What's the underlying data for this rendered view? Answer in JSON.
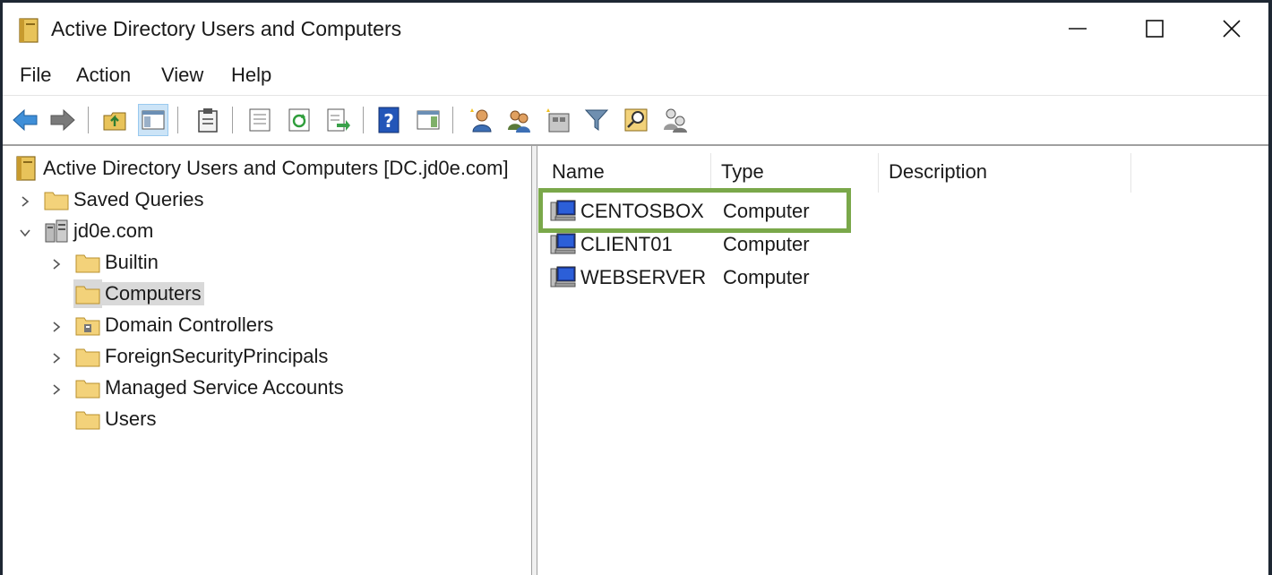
{
  "window": {
    "title": "Active Directory Users and Computers",
    "controls": [
      "minimize",
      "maximize",
      "close"
    ]
  },
  "menu": {
    "file": "File",
    "action": "Action",
    "view": "View",
    "help": "Help"
  },
  "toolbar": {
    "icons": [
      "back-arrow-icon",
      "forward-arrow-icon",
      "up-folder-icon",
      "show-console-tree-icon",
      "clipboard-icon",
      "properties-icon",
      "refresh-icon",
      "export-list-icon",
      "help-icon",
      "action-pane-icon",
      "new-user-icon",
      "new-group-icon",
      "new-ou-icon",
      "filter-icon",
      "find-icon",
      "add-to-group-icon"
    ]
  },
  "tree": {
    "root": "Active Directory Users and Computers [DC.jd0e.com]",
    "items": [
      {
        "label": "Saved Queries"
      },
      {
        "label": "jd0e.com"
      },
      {
        "label": "Builtin"
      },
      {
        "label": "Computers"
      },
      {
        "label": "Domain Controllers"
      },
      {
        "label": "ForeignSecurityPrincipals"
      },
      {
        "label": "Managed Service Accounts"
      },
      {
        "label": "Users"
      }
    ],
    "selected": "Computers"
  },
  "list": {
    "columns": [
      "Name",
      "Type",
      "Description"
    ],
    "rows": [
      {
        "name": "CENTOSBOX",
        "type": "Computer",
        "description": ""
      },
      {
        "name": "CLIENT01",
        "type": "Computer",
        "description": ""
      },
      {
        "name": "WEBSERVER",
        "type": "Computer",
        "description": ""
      }
    ]
  },
  "colors": {
    "highlight": "#7aa84a",
    "selection": "#d9d9d9",
    "background": "#ffffff"
  }
}
